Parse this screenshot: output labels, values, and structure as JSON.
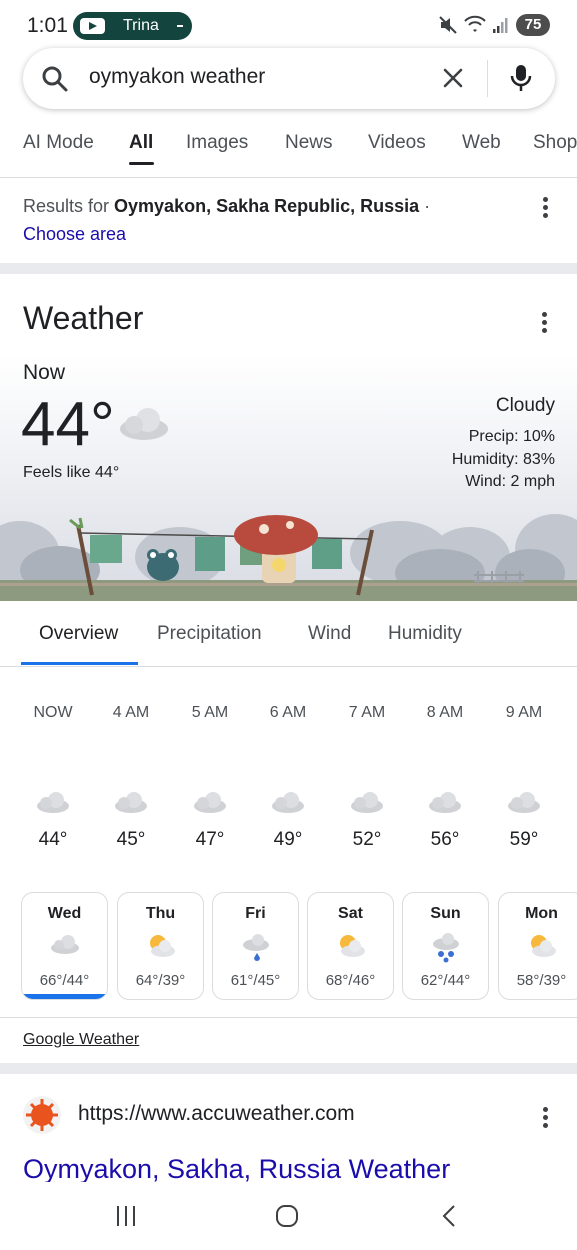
{
  "status_bar": {
    "time": "1:01",
    "media_app": "Trina",
    "battery": "75",
    "icons": [
      "mute-icon",
      "wifi-icon",
      "signal-icon",
      "battery-icon"
    ]
  },
  "search": {
    "query": "oymyakon weather"
  },
  "tabs": [
    {
      "label": "AI Mode",
      "active": false
    },
    {
      "label": "All",
      "active": true
    },
    {
      "label": "Images",
      "active": false
    },
    {
      "label": "News",
      "active": false
    },
    {
      "label": "Videos",
      "active": false
    },
    {
      "label": "Web",
      "active": false
    },
    {
      "label": "Shop",
      "active": false
    }
  ],
  "location": {
    "prefix": "Results for ",
    "place": "Oymyakon, Sakha Republic, Russia",
    "suffix": " ·",
    "choose_area": "Choose area"
  },
  "weather": {
    "title": "Weather",
    "now_label": "Now",
    "temperature": "44°",
    "feels_like": "Feels like 44°",
    "condition": "Cloudy",
    "precip": "Precip: 10%",
    "humidity": "Humidity: 83%",
    "wind": "Wind: 2 mph",
    "view_tabs": [
      "Overview",
      "Precipitation",
      "Wind",
      "Humidity"
    ],
    "hourly": [
      {
        "time": "NOW",
        "temp": "44°",
        "icon": "cloud-icon"
      },
      {
        "time": "4 AM",
        "temp": "45°",
        "icon": "cloud-icon"
      },
      {
        "time": "5 AM",
        "temp": "47°",
        "icon": "cloud-icon"
      },
      {
        "time": "6 AM",
        "temp": "49°",
        "icon": "cloud-icon"
      },
      {
        "time": "7 AM",
        "temp": "52°",
        "icon": "cloud-icon"
      },
      {
        "time": "8 AM",
        "temp": "56°",
        "icon": "cloud-icon"
      },
      {
        "time": "9 AM",
        "temp": "59°",
        "icon": "cloud-icon"
      }
    ],
    "daily": [
      {
        "day": "Wed",
        "range": "66°/44°",
        "icon": "cloud-icon",
        "selected": true
      },
      {
        "day": "Thu",
        "range": "64°/39°",
        "icon": "partly-sunny-icon",
        "selected": false
      },
      {
        "day": "Fri",
        "range": "61°/45°",
        "icon": "rain-icon",
        "selected": false
      },
      {
        "day": "Sat",
        "range": "68°/46°",
        "icon": "partly-sunny-icon",
        "selected": false
      },
      {
        "day": "Sun",
        "range": "62°/44°",
        "icon": "showers-icon",
        "selected": false
      },
      {
        "day": "Mon",
        "range": "58°/39°",
        "icon": "partly-sunny-icon",
        "selected": false
      }
    ],
    "source_link": "Google Weather"
  },
  "result": {
    "url": "https://www.accuweather.com",
    "title": "Oymyakon, Sakha, Russia Weather"
  },
  "colors": {
    "link_blue": "#1a0dab",
    "accent_blue": "#1a73e8",
    "media_pill": "#13453e"
  }
}
